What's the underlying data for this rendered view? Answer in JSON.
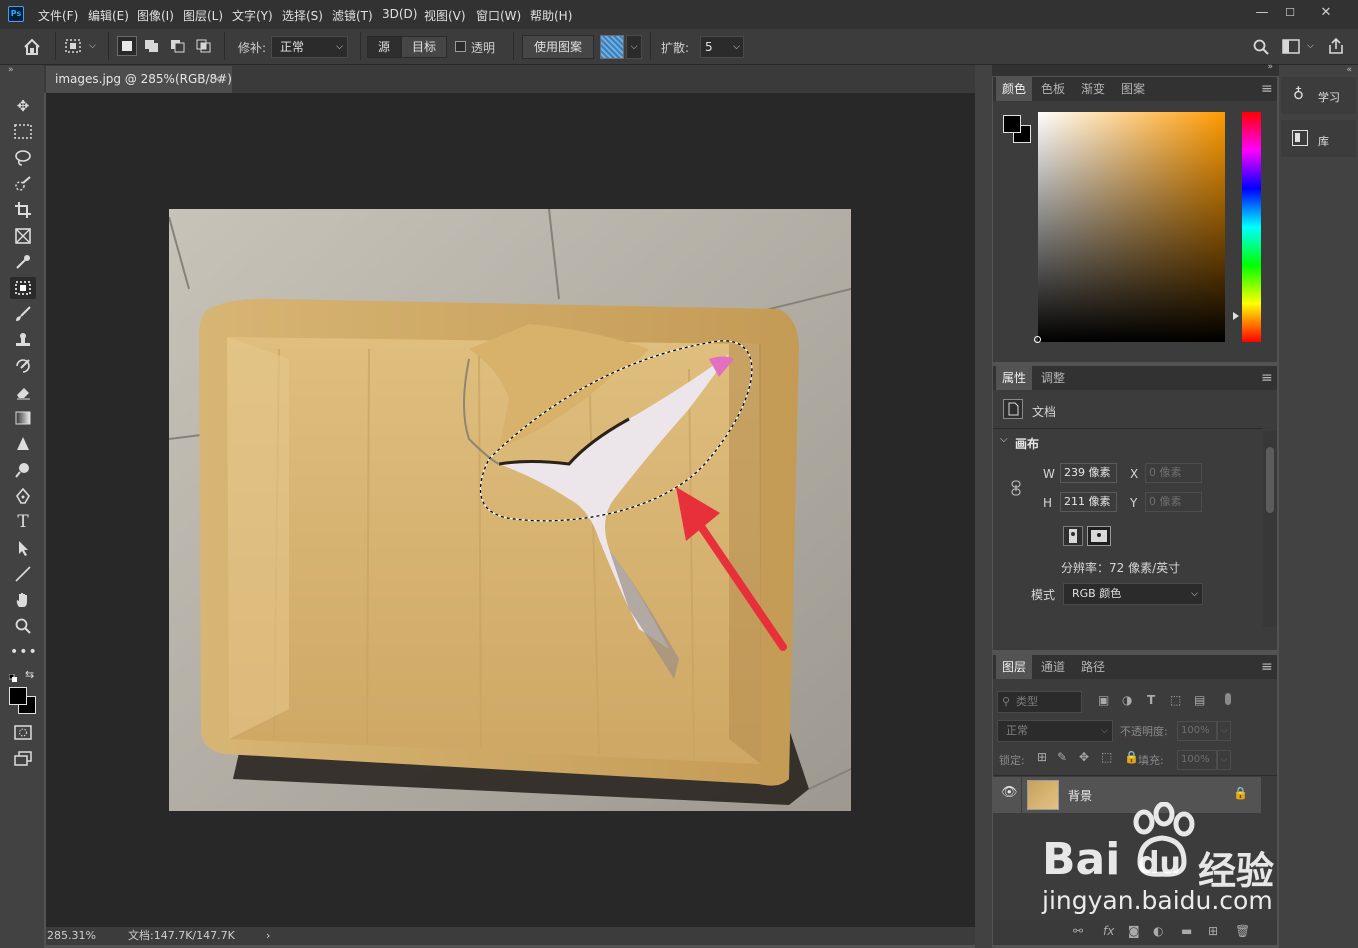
{
  "menubar": {
    "app_logo": "Ps",
    "items": [
      "文件(F)",
      "编辑(E)",
      "图像(I)",
      "图层(L)",
      "文字(Y)",
      "选择(S)",
      "滤镜(T)",
      "3D(D)",
      "视图(V)",
      "窗口(W)",
      "帮助(H)"
    ],
    "minimize": "—",
    "maximize": "☐",
    "close": "✕"
  },
  "options": {
    "patch_label": "修补:",
    "patch_mode": "正常",
    "source_label": "源",
    "dest_label": "目标",
    "transparent_label": "透明",
    "use_pattern_label": "使用图案",
    "diffusion_label": "扩散:",
    "diffusion_value": "5"
  },
  "document": {
    "tab_title": "images.jpg @ 285%(RGB/8#)",
    "tab_close": "×",
    "zoom": "285.31%",
    "doc_size": "文档:147.7K/147.7K",
    "status_arrow": "›"
  },
  "color_panel": {
    "tabs": [
      "颜色",
      "色板",
      "渐变",
      "图案"
    ]
  },
  "side_panel": {
    "learn_label": "学习",
    "library_label": "库"
  },
  "properties_panel": {
    "tabs": [
      "属性",
      "调整"
    ],
    "doc_label": "文档",
    "canvas_section": "画布",
    "w_label": "W",
    "w_value": "239 像素",
    "h_label": "H",
    "h_value": "211 像素",
    "x_label": "X",
    "x_value": "0 像素",
    "y_label": "Y",
    "y_value": "0 像素",
    "resolution": "分辨率：72 像素/英寸",
    "mode_label": "模式",
    "mode_value": "RGB 颜色"
  },
  "layers_panel": {
    "tabs": [
      "图层",
      "通道",
      "路径"
    ],
    "filter_placeholder": "类型",
    "blend_mode": "正常",
    "opacity_label": "不透明度:",
    "opacity_value": "100%",
    "lock_label": "锁定:",
    "fill_label": "填充:",
    "fill_value": "100%",
    "layer_name": "背景"
  },
  "watermark": {
    "brand": "Bai",
    "brand2": "du",
    "cn": "经验",
    "url": "jingyan.baidu.com"
  },
  "colors": {
    "accent_arrow": "#e8303a",
    "cardboard": "#d6b06d"
  }
}
